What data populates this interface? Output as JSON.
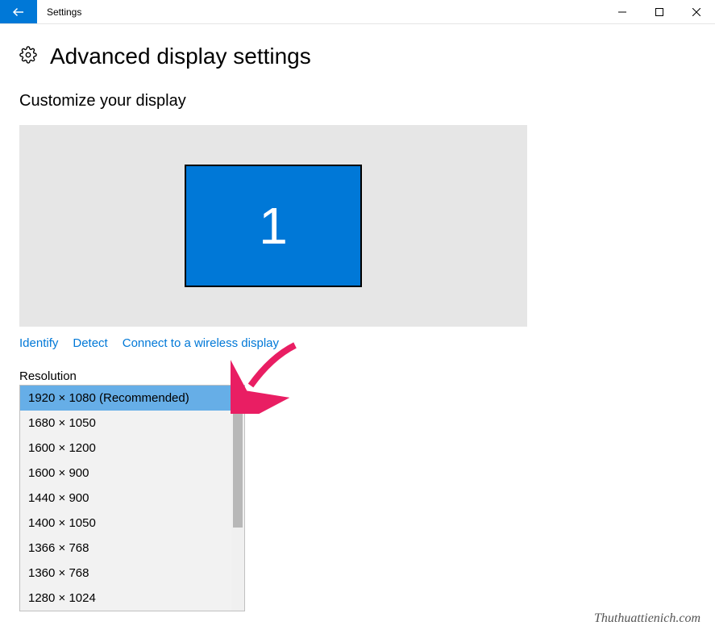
{
  "titlebar": {
    "title": "Settings"
  },
  "header": {
    "title": "Advanced display settings"
  },
  "section": {
    "heading": "Customize your display"
  },
  "monitor": {
    "number": "1"
  },
  "links": {
    "identify": "Identify",
    "detect": "Detect",
    "wireless": "Connect to a wireless display"
  },
  "resolution": {
    "label": "Resolution",
    "options": [
      "1920 × 1080 (Recommended)",
      "1680 × 1050",
      "1600 × 1200",
      "1600 × 900",
      "1440 × 900",
      "1400 × 1050",
      "1366 × 768",
      "1360 × 768",
      "1280 × 1024"
    ],
    "selected_index": 0
  },
  "watermark": "Thuthuattienich.com"
}
